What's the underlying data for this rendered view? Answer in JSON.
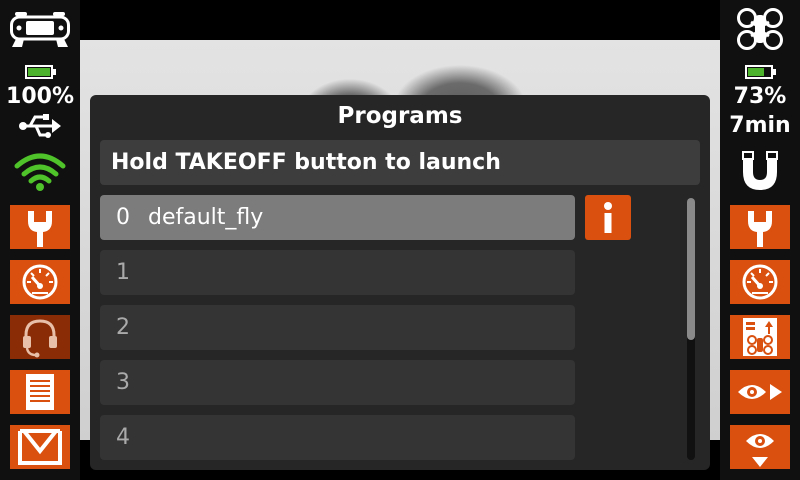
{
  "left_bar": {
    "battery_percent": "100%",
    "battery_level": 1.0,
    "buttons": [
      {
        "name": "wrench-icon"
      },
      {
        "name": "gauge-icon"
      },
      {
        "name": "headset-icon"
      },
      {
        "name": "document-icon"
      },
      {
        "name": "download-icon"
      }
    ]
  },
  "right_bar": {
    "battery_percent": "73%",
    "battery_level": 0.73,
    "flight_time": "7min",
    "buttons": [
      {
        "name": "wrench-icon"
      },
      {
        "name": "gauge-icon"
      },
      {
        "name": "drone-calibration-icon"
      },
      {
        "name": "eye-forward-icon"
      },
      {
        "name": "eye-down-icon"
      }
    ]
  },
  "dialog": {
    "title": "Programs",
    "banner": "Hold TAKEOFF button to launch",
    "info_label": "i",
    "programs": [
      {
        "index": "0",
        "name": "default_fly"
      },
      {
        "index": "1",
        "name": ""
      },
      {
        "index": "2",
        "name": ""
      },
      {
        "index": "3",
        "name": ""
      },
      {
        "index": "4",
        "name": ""
      }
    ]
  },
  "colors": {
    "accent": "#d9500f",
    "battery_green": "#4cb32d",
    "wifi_green": "#4fc32a",
    "panel_bg": "#262626",
    "row_bg": "#343434",
    "row_selected_bg": "#7c7c7c"
  }
}
